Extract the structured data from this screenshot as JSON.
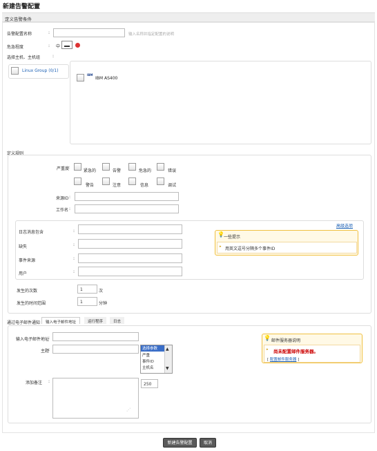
{
  "page": {
    "title": "新建告警配置"
  },
  "section": {
    "condition_header": "定义告警条件"
  },
  "form": {
    "name_label": "告警配置名称",
    "name_hint": "输入名称并指定配置的说明",
    "severity_label": "危急程度",
    "severity_value": "中",
    "hosts_label": "选择主机、主机组",
    "host_group": "Linux Group (0/1)",
    "host_item": {
      "badge": "IBM",
      "name": "IBM AS400"
    }
  },
  "rules": {
    "header": "定义规则",
    "priority_label": "严重度",
    "priority_options": [
      "紧急的",
      "告警",
      "危急的",
      "错误",
      "警告",
      "注意",
      "信息",
      "调试"
    ],
    "source_id_label": "来源ID",
    "job_label": "工作名",
    "adv_link": "高级选项",
    "fields": [
      "日志消息包含",
      "缺失",
      "事件来源",
      "用户"
    ],
    "tip_title": "一些提示",
    "tip_text": "用英文逗号分隔多个事件ID",
    "times_label": "发生的次数",
    "times_value": "1",
    "times_unit": "次",
    "window_label": "发生的时间范围",
    "window_value": "1",
    "window_unit": "分钟"
  },
  "actions": {
    "label": "通过电子邮件通知",
    "tabs": [
      "输入电子邮件地址",
      "运行程序",
      "日志"
    ],
    "email_label": "输入电子邮件地址",
    "subject_label": "主题",
    "variables": [
      "选择参数",
      "严重",
      "事件ID",
      "主机名"
    ],
    "extra_label": "添加备注",
    "count": "250",
    "mail_tip_title": "邮件服务器说明",
    "mail_tip_warning": "尚未配置邮件服务器。",
    "mail_tip_link": "配置邮件服务器"
  },
  "buttons": {
    "save": "新建告警配置",
    "cancel": "取消"
  }
}
